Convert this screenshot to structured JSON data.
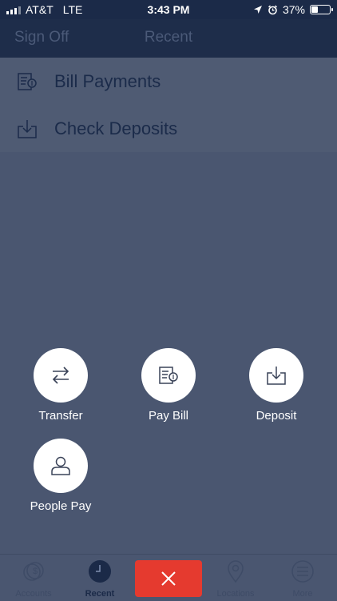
{
  "status_bar": {
    "carrier": "AT&T",
    "network": "LTE",
    "time": "3:43 PM",
    "battery": "37%",
    "battery_level": 0.37
  },
  "nav": {
    "left_button": "Sign Off",
    "title": "Recent"
  },
  "menu": {
    "items": [
      {
        "label": "Bill Payments",
        "icon": "bill-icon"
      },
      {
        "label": "Check Deposits",
        "icon": "deposit-icon"
      }
    ]
  },
  "actions": [
    {
      "label": "Transfer",
      "icon": "transfer-icon"
    },
    {
      "label": "Pay Bill",
      "icon": "pay-bill-icon"
    },
    {
      "label": "Deposit",
      "icon": "deposit-icon"
    },
    {
      "label": "People Pay",
      "icon": "person-icon"
    }
  ],
  "tabs": [
    {
      "label": "Accounts",
      "icon": "dollar-icon"
    },
    {
      "label": "Recent",
      "icon": "clock-icon",
      "active": true
    },
    {
      "label": "Locations",
      "icon": "location-pin-icon"
    },
    {
      "label": "More",
      "icon": "menu-icon"
    }
  ],
  "colors": {
    "nav_bg": "#1e2d4a",
    "overlay": "#4a5670",
    "close_button": "#e53a2f"
  }
}
